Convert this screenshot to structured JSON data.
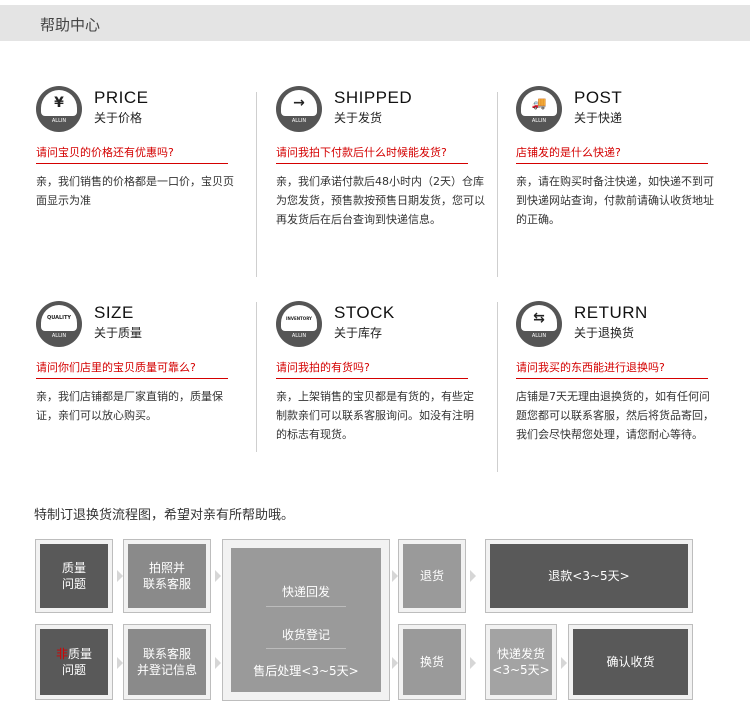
{
  "header": {
    "title": "帮助中心"
  },
  "cards": [
    {
      "en": "PRICE",
      "cn": "关于价格",
      "icon": "yen-icon",
      "glyph": "¥",
      "question": "请问宝贝的价格还有优惠吗?",
      "answer": "亲，我们销售的价格都是一口价，宝贝页面显示为准"
    },
    {
      "en": "SHIPPED",
      "cn": "关于发货",
      "icon": "arrow-right-icon",
      "glyph": "→",
      "question": "请问我拍下付款后什么时候能发货?",
      "answer": "亲，我们承诺付款后48小时内（2天）仓库为您发货，预售款按预售日期发货，您可以再发货后在后台查询到快递信息。"
    },
    {
      "en": "POST",
      "cn": "关于快递",
      "icon": "truck-icon",
      "glyph": "🚚",
      "question": "店铺发的是什么快递?",
      "answer": "亲，请在购买时备注快递，如快递不到可到快递网站查询，付款前请确认收货地址的正确。"
    },
    {
      "en": "SIZE",
      "cn": "关于质量",
      "icon": "quality-icon",
      "glyph": "QUALITY",
      "question": "请问你们店里的宝贝质量可靠么?",
      "answer": "亲，我们店铺都是厂家直销的，质量保证，亲们可以放心购买。"
    },
    {
      "en": "STOCK",
      "cn": "关于库存",
      "icon": "inventory-icon",
      "glyph": "INVENTORY",
      "question": "请问我拍的有货吗?",
      "answer": "亲，上架销售的宝贝都是有货的，有些定制款亲们可以联系客服询问。如没有注明的标志有现货。"
    },
    {
      "en": "RETURN",
      "cn": "关于退换货",
      "icon": "exchange-icon",
      "glyph": "⇆",
      "question": "请问我买的东西能进行退换吗?",
      "answer": "店铺是7天无理由退换货的，如有任何问题您都可以联系客服，然后将货品寄回，我们会尽快帮您处理，请您耐心等待。"
    }
  ],
  "allin_label": "ALLIN",
  "flow": {
    "caption": "特制订退换货流程图，希望对亲有所帮助哦。",
    "row1_start_a": "质量",
    "row1_start_b": "问题",
    "row1_contact_a": "拍照并",
    "row1_contact_b": "联系客服",
    "center_1": "快递回发",
    "center_2": "收货登记",
    "center_3": "售后处理<3~5天>",
    "return_goods": "退货",
    "refund": "退款<3~5天>",
    "row2_mark": "非",
    "row2_start_a": "质量",
    "row2_start_b": "问题",
    "row2_contact_a": "联系客服",
    "row2_contact_b": "并登记信息",
    "exchange": "换货",
    "express_a": "快递发货",
    "express_b": "<3~5天>",
    "confirm": "确认收货"
  }
}
